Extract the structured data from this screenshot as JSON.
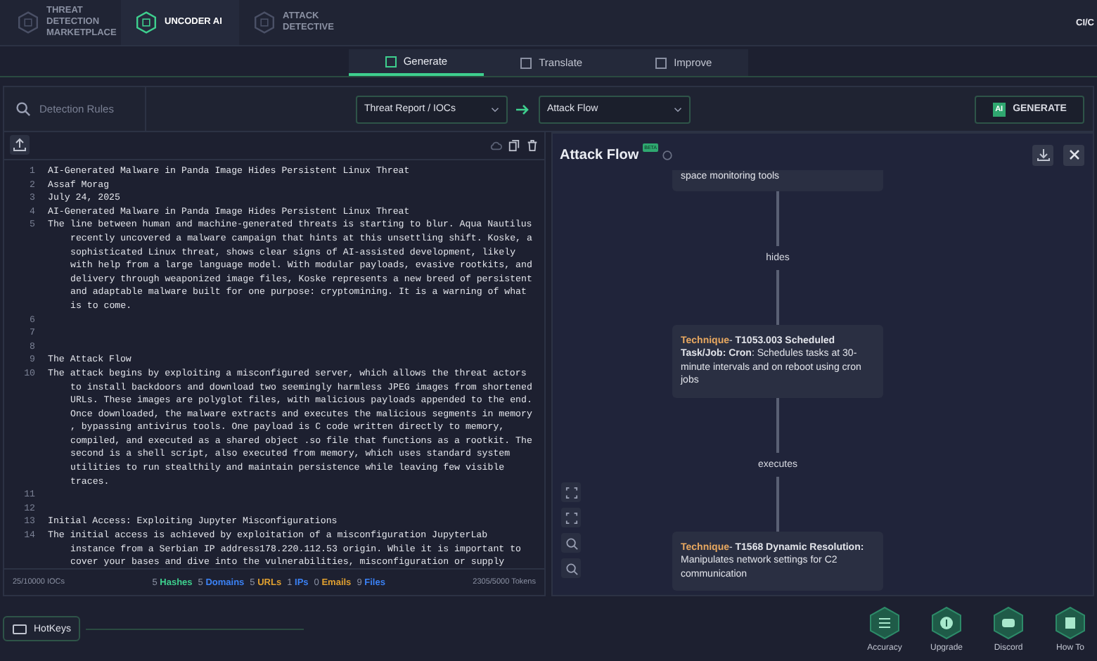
{
  "nav": {
    "items": [
      {
        "label": "THREAT DETECTION MARKETPLACE",
        "selected": false
      },
      {
        "label": "UNCODER AI",
        "selected": true
      },
      {
        "label": "ATTACK DETECTIVE",
        "selected": false
      }
    ],
    "right": "CI/C"
  },
  "tabs": [
    {
      "label": "Generate",
      "selected": true
    },
    {
      "label": "Translate",
      "selected": false
    },
    {
      "label": "Improve",
      "selected": false
    }
  ],
  "toolbar": {
    "search": {
      "placeholder": "Detection Rules"
    },
    "source": "Threat Report / IOCs",
    "target": "Attack Flow",
    "generate": "GENERATE",
    "generate_badge": "AI"
  },
  "editor": {
    "lines": [
      {
        "number": "1",
        "text": [
          "AI-Generated Malware in Panda Image Hides Persistent Linux Threat"
        ]
      },
      {
        "number": "2",
        "text": [
          "Assaf Morag"
        ]
      },
      {
        "number": "3",
        "text": [
          "July 24, 2025"
        ]
      },
      {
        "number": "4",
        "text": [
          "AI-Generated Malware in Panda Image Hides Persistent Linux Threat"
        ]
      },
      {
        "number": "5",
        "text": [
          "The line between human and machine-generated threats is starting to blur. Aqua Nautilus",
          "recently uncovered a malware campaign that hints at this unsettling shift. Koske, a",
          "sophisticated Linux threat, shows clear signs of AI-assisted development, likely",
          "with help from a large language model. With modular payloads, evasive rootkits, and",
          "delivery through weaponized image files, Koske represents a new breed of persistent",
          "and adaptable malware built for one purpose: cryptomining. It is a warning of what",
          "is to come."
        ]
      },
      {
        "number": "6"
      },
      {
        "number": "7"
      },
      {
        "number": "8"
      },
      {
        "number": "9",
        "text": [
          "The Attack Flow"
        ]
      },
      {
        "number": "10",
        "text": [
          "The attack begins by exploiting a misconfigured server, which allows the threat actors",
          "to install backdoors and download two seemingly harmless JPEG images from shortened",
          "URLs. These images are polyglot files, with malicious payloads appended to the end.",
          "Once downloaded, the malware extracts and executes the malicious segments in memory",
          ", bypassing antivirus tools. One payload is C code written directly to memory,",
          "compiled, and executed as a shared object .so file that functions as a rootkit. The",
          "second is a shell script, also executed from memory, which uses standard system",
          "utilities to run stealthily and maintain persistence while leaving few visible",
          "traces."
        ]
      },
      {
        "number": "11"
      },
      {
        "number": "12"
      },
      {
        "number": "13",
        "text": [
          "Initial Access: Exploiting Jupyter Misconfigurations"
        ]
      },
      {
        "number": "14",
        "text": [
          "The initial access is achieved by exploitation of a misconfiguration JupyterLab",
          "instance from a Serbian IP address178.220.112.53 origin. While it is important to",
          "cover your bases and dive into the vulnerabilities, misconfiguration or supply"
        ]
      }
    ]
  },
  "stats": {
    "iocs": "25/10000 IOCs",
    "counts": [
      {
        "count": "5",
        "label": "Hashes",
        "color": "#3ecf8e"
      },
      {
        "count": "5",
        "label": "Domains",
        "color": "#3b82f6"
      },
      {
        "count": "5",
        "label": "URLs",
        "color": "#e0a030"
      },
      {
        "count": "1",
        "label": "IPs",
        "color": "#3b82f6"
      },
      {
        "count": "0",
        "label": "Emails",
        "color": "#e0a030"
      },
      {
        "count": "9",
        "label": "Files",
        "color": "#3b82f6"
      }
    ],
    "tokens": "2305/5000 Tokens"
  },
  "flow": {
    "title": "Attack Flow",
    "badge": "BETA",
    "nodes": [
      {
        "text": "space monitoring tools"
      },
      {
        "label": "Technique",
        "text": "- **T1053.003 Scheduled Task/Job: Cron**: Schedules tasks at 30-minute intervals and on reboot using cron jobs"
      },
      {
        "label": "Technique",
        "text": "- **T1568 Dynamic Resolution:** Manipulates network settings for C2 communication"
      }
    ],
    "edges": [
      "hides",
      "executes"
    ]
  },
  "hotkeys": "HotKeys",
  "footer": [
    {
      "label": "Accuracy",
      "kind": "list"
    },
    {
      "label": "Upgrade",
      "kind": "dollar"
    },
    {
      "label": "Discord",
      "kind": "chat"
    },
    {
      "label": "How To",
      "kind": "book"
    }
  ]
}
